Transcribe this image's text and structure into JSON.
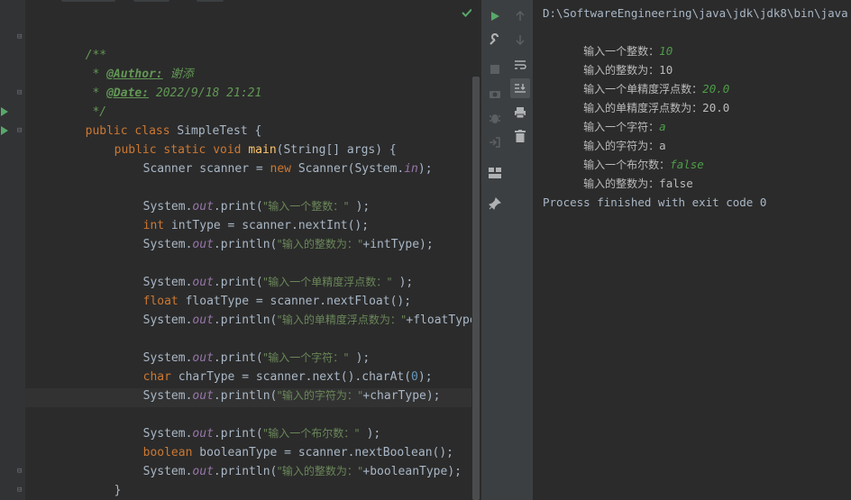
{
  "editor": {
    "javadoc": {
      "open": "/**",
      "author_tag": "@Author:",
      "author_value": "谢添",
      "date_tag": "@Date:",
      "date_value": "2022/9/18 21:21",
      "close": "*/"
    },
    "class_decl": {
      "kw": "public class",
      "name": "SimpleTest",
      "brace": "{"
    },
    "main_decl": {
      "kw": "public static void",
      "name": "main",
      "params": "(String[] args) {"
    },
    "scanner_line": {
      "type": "Scanner scanner = ",
      "new": "new",
      "rest_a": " Scanner(System.",
      "in": "in",
      "rest_b": ");"
    },
    "blocks": [
      {
        "print_a": "System.",
        "out": "out",
        "print_b": ".print(",
        "prompt": "\"输入一个整数：\"",
        "print_c": " );",
        "decl_kw": "int",
        "decl_rest": " intType = scanner.nextInt();",
        "println_b": ".println(",
        "echo": "\"输入的整数为：\"",
        "echo_rest": "+intType);"
      },
      {
        "print_a": "System.",
        "out": "out",
        "print_b": ".print(",
        "prompt": "\"输入一个单精度浮点数：\"",
        "print_c": " );",
        "decl_kw": "float",
        "decl_rest": " floatType = scanner.nextFloat();",
        "println_b": ".println(",
        "echo": "\"输入的单精度浮点数为：\"",
        "echo_rest": "+floatType);"
      },
      {
        "print_a": "System.",
        "out": "out",
        "print_b": ".print(",
        "prompt": "\"输入一个字符：\"",
        "print_c": " );",
        "decl_kw": "char",
        "decl_rest_a": " charType = scanner.next().charAt(",
        "decl_num": "0",
        "decl_rest_b": ");",
        "println_b": ".println(",
        "echo": "\"输入的字符为：\"",
        "echo_rest": "+charType);"
      },
      {
        "print_a": "System.",
        "out": "out",
        "print_b": ".print(",
        "prompt": "\"输入一个布尔数：\"",
        "print_c": " );",
        "decl_kw": "boolean",
        "decl_rest": " booleanType = scanner.nextBoolean();",
        "println_b": ".println(",
        "echo": "\"输入的整数为：\"",
        "echo_rest": "+booleanType);"
      }
    ],
    "close_method": "}",
    "close_class": "}"
  },
  "console": {
    "command_path": "D:\\SoftwareEngineering\\java\\jdk\\jdk8\\bin\\java",
    "lines": [
      {
        "prompt": "输入一个整数：",
        "value": "10",
        "user_input": true
      },
      {
        "prompt": "输入的整数为：",
        "value": "10",
        "user_input": false
      },
      {
        "prompt": "输入一个单精度浮点数：",
        "value": "20.0",
        "user_input": true
      },
      {
        "prompt": "输入的单精度浮点数为：",
        "value": "20.0",
        "user_input": false
      },
      {
        "prompt": "输入一个字符：",
        "value": "a",
        "user_input": true
      },
      {
        "prompt": "输入的字符为：",
        "value": "a",
        "user_input": false
      },
      {
        "prompt": "输入一个布尔数：",
        "value": "false",
        "user_input": true
      },
      {
        "prompt": "输入的整数为：",
        "value": "false",
        "user_input": false
      }
    ],
    "exit_message": "Process finished with exit code 0"
  },
  "toolbar": {
    "icons": [
      "rerun-icon",
      "scroll-up-icon",
      "wrench-icon",
      "scroll-down-icon",
      "stop-icon",
      "soft-wrap-icon",
      "camera-icon",
      "scroll-to-end-icon",
      "debug-icon",
      "print-icon",
      "exit-icon",
      "trash-icon",
      "layout-icon",
      "pin-icon"
    ]
  },
  "colors": {
    "background": "#2b2b2b",
    "keyword": "#cc7832",
    "method": "#ffc66d",
    "string": "#6a8759",
    "static_field": "#9876aa",
    "javadoc": "#629755",
    "run_green": "#59a869",
    "input_green": "#4f9d4a"
  }
}
